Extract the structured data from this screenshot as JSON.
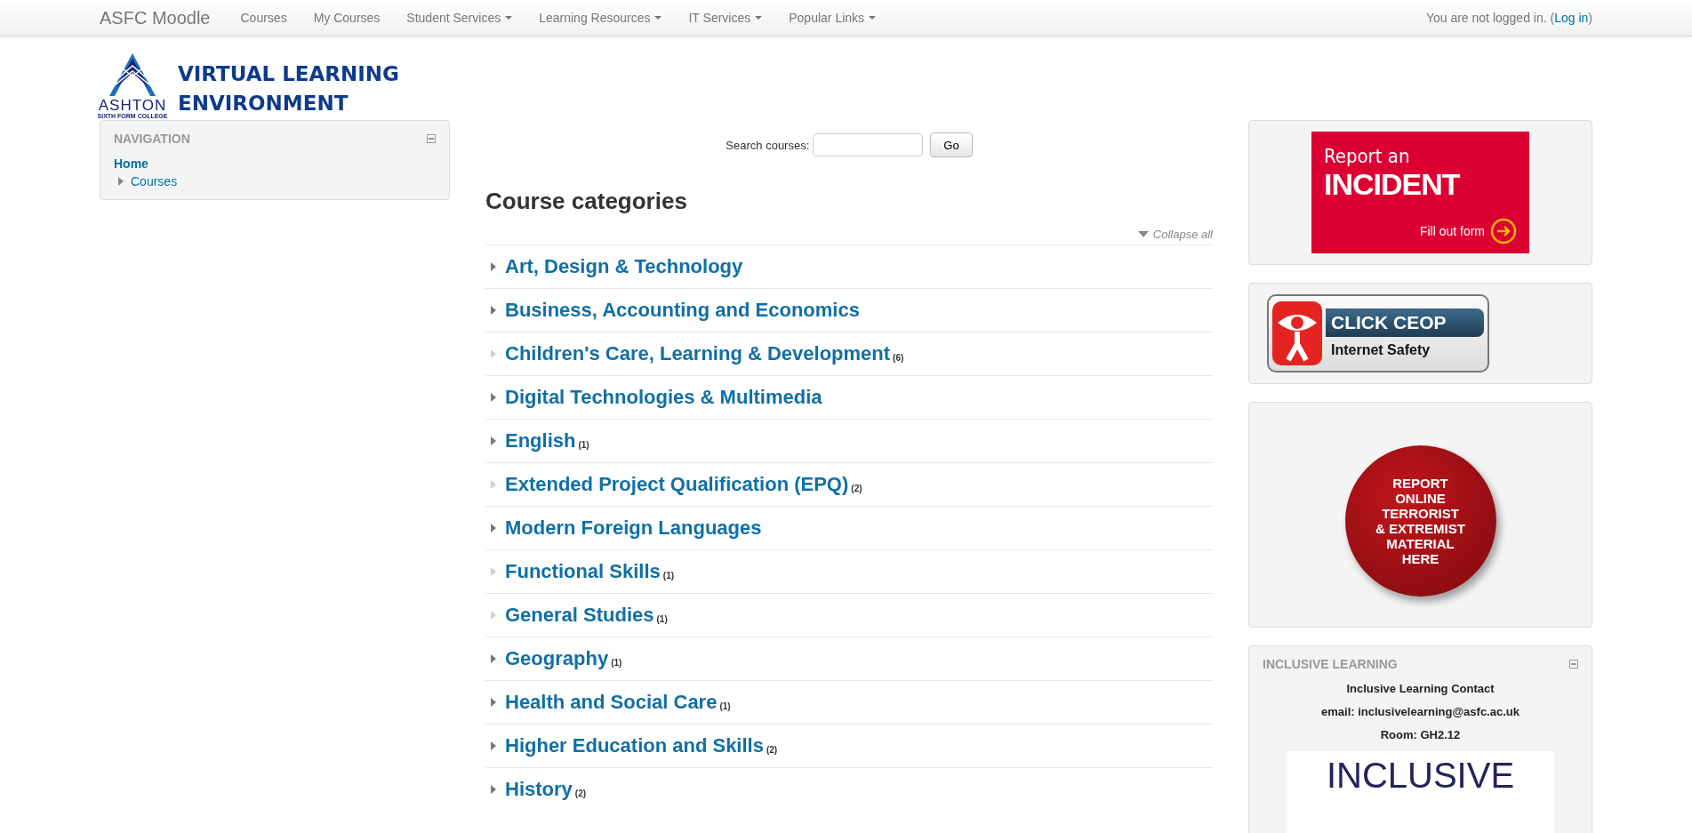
{
  "navbar": {
    "brand": "ASFC Moodle",
    "menu": [
      {
        "label": "Courses",
        "dropdown": false
      },
      {
        "label": "My Courses",
        "dropdown": false
      },
      {
        "label": "Student Services",
        "dropdown": true
      },
      {
        "label": "Learning Resources",
        "dropdown": true
      },
      {
        "label": "IT Services",
        "dropdown": true
      },
      {
        "label": "Popular Links",
        "dropdown": true
      }
    ],
    "login_text": "You are not logged in. (",
    "login_link": "Log in",
    "login_close": ")"
  },
  "logo": {
    "college": "ASHTON",
    "college_sub": "SIXTH FORM COLLEGE",
    "title_line1": "VIRTUAL LEARNING",
    "title_line2": "ENVIRONMENT"
  },
  "navigation_block": {
    "title": "NAVIGATION",
    "home": "Home",
    "items": [
      {
        "label": "Courses",
        "expanded": false
      }
    ]
  },
  "search": {
    "label": "Search courses:",
    "button": "Go"
  },
  "heading": "Course categories",
  "collapse_all": "Collapse all",
  "categories": [
    {
      "name": "Art, Design & Technology",
      "expandable": true
    },
    {
      "name": "Business, Accounting and Economics",
      "expandable": true
    },
    {
      "name": "Children's Care, Learning & Development",
      "expandable": false,
      "count": "(6)"
    },
    {
      "name": "Digital Technologies & Multimedia",
      "expandable": true
    },
    {
      "name": "English",
      "expandable": true,
      "count": "(1)"
    },
    {
      "name": "Extended Project Qualification (EPQ)",
      "expandable": false,
      "count": "(2)"
    },
    {
      "name": "Modern Foreign Languages",
      "expandable": true
    },
    {
      "name": "Functional Skills",
      "expandable": false,
      "count": "(1)"
    },
    {
      "name": "General Studies",
      "expandable": false,
      "count": "(1)"
    },
    {
      "name": "Geography",
      "expandable": true,
      "count": "(1)"
    },
    {
      "name": "Health and Social Care",
      "expandable": true,
      "count": "(1)"
    },
    {
      "name": "Higher Education and Skills",
      "expandable": true,
      "count": "(2)"
    },
    {
      "name": "History",
      "expandable": true,
      "count": "(2)"
    }
  ],
  "incident_banner": {
    "line1": "Report an",
    "line2": "INCIDENT",
    "action": "Fill out form"
  },
  "ceop_banner": {
    "title": "CLICK CEOP",
    "subtitle": "Internet Safety"
  },
  "terror_badge": {
    "lines": [
      "REPORT",
      "ONLINE",
      "TERRORIST",
      "& EXTREMIST",
      "MATERIAL",
      "HERE"
    ]
  },
  "inclusive_block": {
    "title": "INCLUSIVE LEARNING",
    "lines": [
      "Inclusive Learning Contact",
      "email: inclusivelearning@asfc.ac.uk",
      "Room: GH2.12"
    ],
    "image_text": "INCLUSIVE"
  }
}
